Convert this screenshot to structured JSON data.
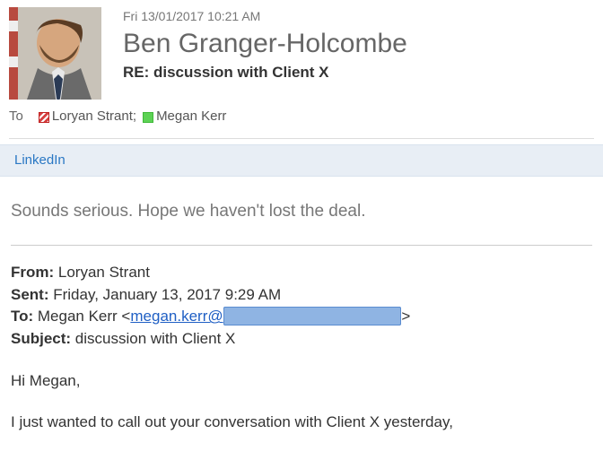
{
  "header": {
    "timestamp": "Fri 13/01/2017 10:21 AM",
    "sender": "Ben Granger-Holcombe",
    "subject": "RE: discussion with Client X"
  },
  "recipients": {
    "to_label": "To",
    "items": [
      {
        "name": "Loryan Strant;",
        "presence": "busy"
      },
      {
        "name": "Megan Kerr",
        "presence": "available"
      }
    ]
  },
  "addin": {
    "linkedin": "LinkedIn"
  },
  "body": {
    "lead": "Sounds serious. Hope we haven't lost the deal."
  },
  "quoted": {
    "from_label": "From:",
    "from_value": " Loryan Strant",
    "sent_label": "Sent:",
    "sent_value": " Friday, January 13, 2017 9:29 AM",
    "to_label": "To:",
    "to_prefix": " Megan Kerr <",
    "to_email_visible": "megan.kerr@",
    "to_email_redacted": "████████████████",
    "to_suffix": ">",
    "subject_label": "Subject:",
    "subject_value": " discussion with Client X",
    "greeting": "Hi Megan,",
    "para1": "I just wanted to call out your conversation with Client X yesterday,"
  }
}
